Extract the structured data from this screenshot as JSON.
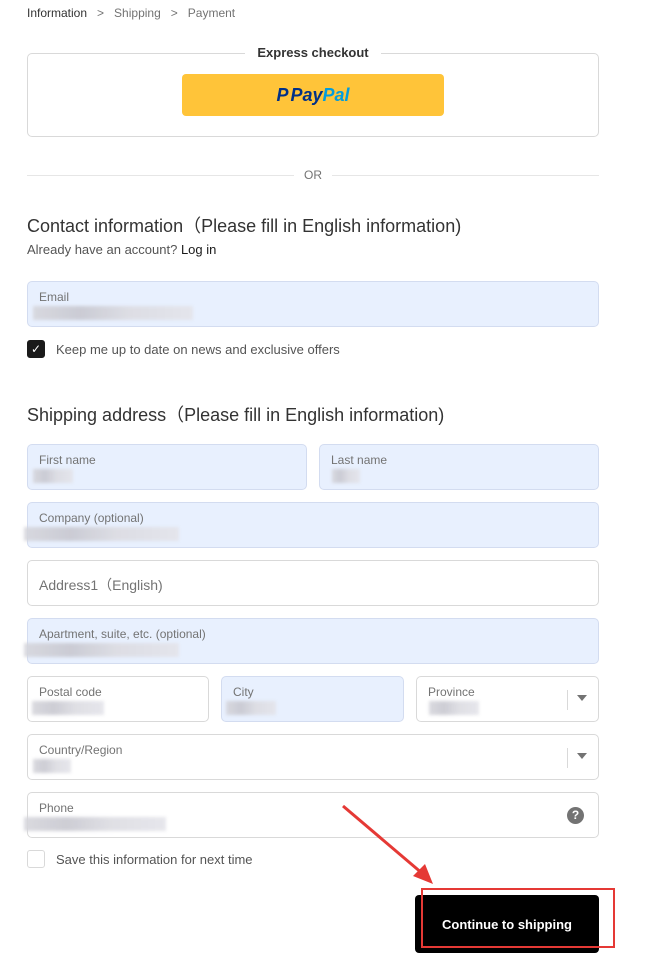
{
  "breadcrumb": {
    "items": [
      "Information",
      "Shipping",
      "Payment"
    ],
    "separator": ">"
  },
  "express": {
    "title": "Express checkout",
    "paypal_mark": "P",
    "paypal_pay": "Pay",
    "paypal_pal": "Pal"
  },
  "divider": {
    "or_text": "OR"
  },
  "contact": {
    "title": "Contact information（Please fill in English information)",
    "account_text": "Already have an account?",
    "login_link": "Log in",
    "email_label": "Email",
    "newsletter_label": "Keep me up to date on news and exclusive offers",
    "newsletter_checked": true
  },
  "shipping": {
    "title": "Shipping address（Please fill in English information)",
    "first_name_label": "First name",
    "last_name_label": "Last name",
    "company_label": "Company (optional)",
    "address1_placeholder": "Address1（English)",
    "address2_label": "Apartment, suite, etc. (optional)",
    "postal_label": "Postal code",
    "city_label": "City",
    "province_label": "Province",
    "country_label": "Country/Region",
    "phone_label": "Phone",
    "save_info_label": "Save this information for next time",
    "save_info_checked": false
  },
  "actions": {
    "continue_label": "Continue to shipping"
  },
  "colors": {
    "autofill_bg": "#e8f0fe",
    "paypal_yellow": "#ffc439",
    "paypal_dark_blue": "#003087",
    "paypal_light_blue": "#009cde",
    "annotation_red": "#e53935",
    "button_black": "#000000"
  },
  "icons": {
    "check": "check-icon",
    "help": "question-circle-icon",
    "dropdown": "chevron-down-icon",
    "breadcrumb_sep": "chevron-right-icon"
  }
}
